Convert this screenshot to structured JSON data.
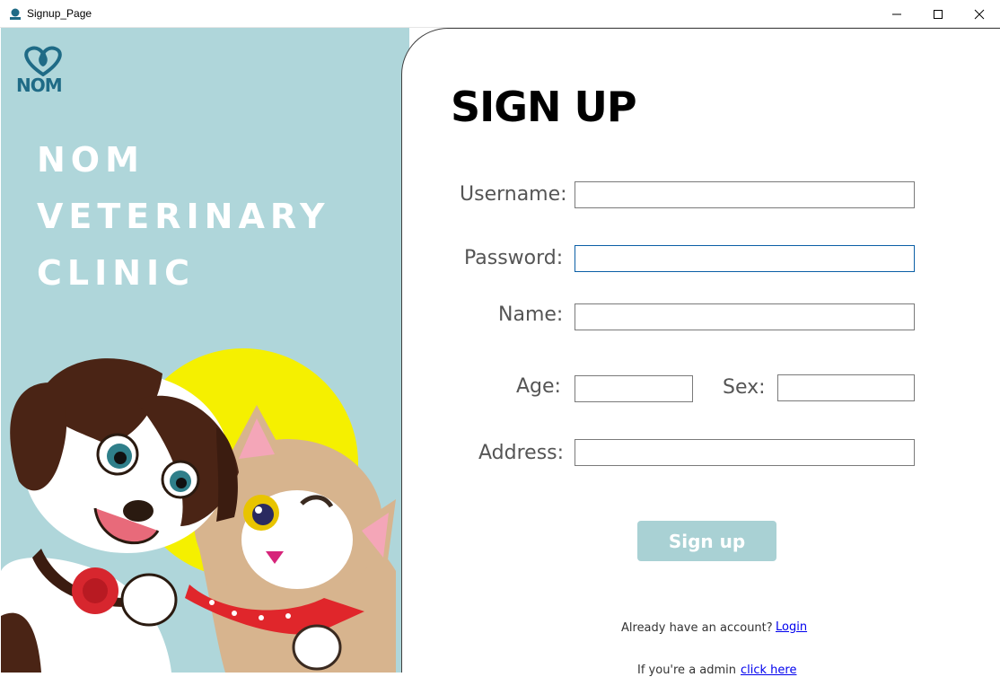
{
  "window": {
    "title": "Signup_Page",
    "controls": [
      "minimize-icon",
      "maximize-icon",
      "close-icon"
    ]
  },
  "brand": {
    "logo_text": "NOM",
    "logo_color": "#1f6b86",
    "clinic_lines": [
      "NOM",
      "VETERINARY",
      "CLINIC"
    ],
    "panel_color": "#afd6da"
  },
  "form": {
    "title": "SIGN UP",
    "fields": {
      "username": {
        "label": "Username:",
        "value": ""
      },
      "password": {
        "label": "Password:",
        "value": ""
      },
      "name": {
        "label": "Name:",
        "value": ""
      },
      "age": {
        "label": "Age:",
        "value": ""
      },
      "sex": {
        "label": "Sex:",
        "value": ""
      },
      "address": {
        "label": "Address:",
        "value": ""
      }
    },
    "submit_label": "Sign up",
    "button_color": "#a9d1d4"
  },
  "footer": {
    "account_text": "Already have an account?",
    "login_link": "Login",
    "admin_text": "If you're a admin",
    "admin_link": "click here"
  }
}
